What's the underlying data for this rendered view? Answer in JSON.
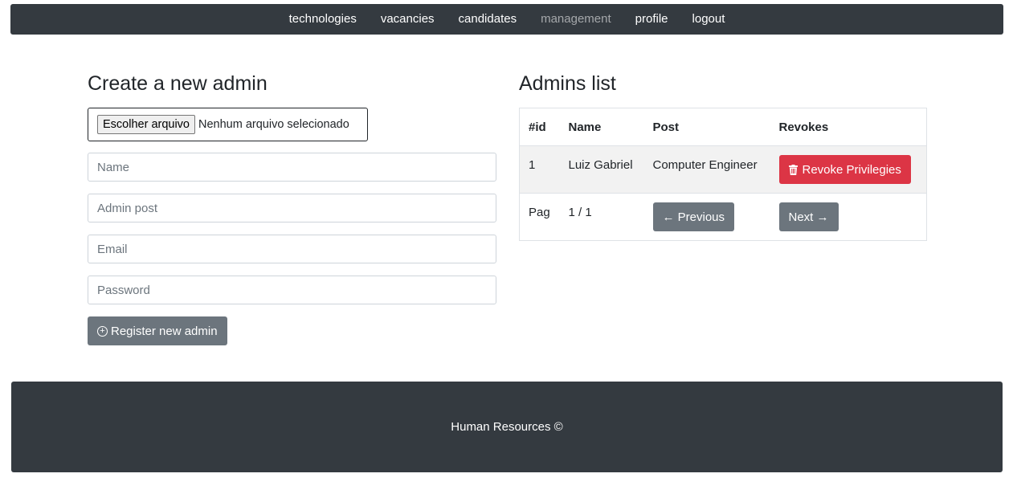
{
  "nav": {
    "items": [
      {
        "label": "technologies",
        "active": false
      },
      {
        "label": "vacancies",
        "active": false
      },
      {
        "label": "candidates",
        "active": false
      },
      {
        "label": "management",
        "active": true
      },
      {
        "label": "profile",
        "active": false
      },
      {
        "label": "logout",
        "active": false
      }
    ]
  },
  "create_form": {
    "title": "Create a new admin",
    "file_button_label": "Escolher arquivo",
    "file_status": "Nenhum arquivo selecionado",
    "name_placeholder": "Name",
    "post_placeholder": "Admin post",
    "email_placeholder": "Email",
    "password_placeholder": "Password",
    "register_label": "Register new admin",
    "register_icon": "plus-circle-icon"
  },
  "admins_list": {
    "title": "Admins list",
    "columns": [
      "#id",
      "Name",
      "Post",
      "Revokes"
    ],
    "rows": [
      {
        "id": "1",
        "name": "Luiz Gabriel",
        "post": "Computer Engineer",
        "action_label": "Revoke Privilegies",
        "action_icon": "trash-icon"
      }
    ],
    "pagination": {
      "label": "Pag",
      "value": "1 / 1",
      "previous_label": "← Previous",
      "next_label": "Next →"
    }
  },
  "footer": {
    "text": "Human Resources ©"
  },
  "colors": {
    "navbar_bg": "#343a40",
    "danger": "#dc3545",
    "secondary": "#6c757d"
  }
}
